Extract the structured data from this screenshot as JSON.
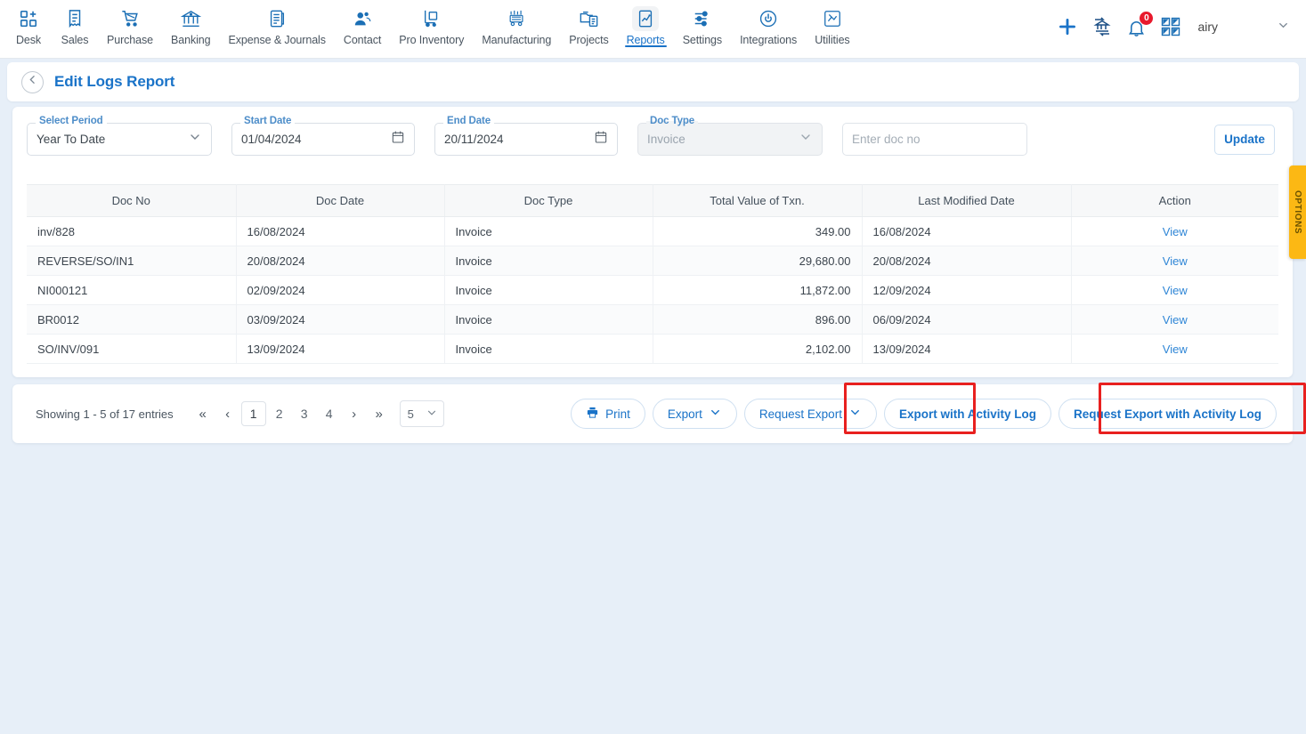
{
  "topnav": {
    "items": [
      {
        "label": "Desk",
        "icon": "dashboard-add-icon",
        "active": false
      },
      {
        "label": "Sales",
        "icon": "receipt-icon",
        "active": false
      },
      {
        "label": "Purchase",
        "icon": "cart-icon",
        "active": false
      },
      {
        "label": "Banking",
        "icon": "bank-icon",
        "active": false
      },
      {
        "label": "Expense & Journals",
        "icon": "ledger-book-icon",
        "active": false
      },
      {
        "label": "Contact",
        "icon": "people-icon",
        "active": false
      },
      {
        "label": "Pro Inventory",
        "icon": "hand-truck-icon",
        "active": false
      },
      {
        "label": "Manufacturing",
        "icon": "factory-machine-icon",
        "active": false
      },
      {
        "label": "Projects",
        "icon": "project-folder-icon",
        "active": false
      },
      {
        "label": "Reports",
        "icon": "report-chart-icon",
        "active": true
      },
      {
        "label": "Settings",
        "icon": "sliders-icon",
        "active": false
      },
      {
        "label": "Integrations",
        "icon": "plug-icon",
        "active": false
      },
      {
        "label": "Utilities",
        "icon": "utilities-icon",
        "active": false
      }
    ],
    "right": {
      "add_icon": "plus-icon",
      "bank_transfer_icon": "bank-transfer-icon",
      "notification_icon": "bell-icon",
      "notification_count": "0",
      "apps_icon": "grid-apps-icon",
      "org_name": "airy",
      "caret_icon": "chevron-down-icon"
    }
  },
  "page": {
    "back_icon": "chevron-left-icon",
    "title": "Edit Logs Report"
  },
  "filters": {
    "period": {
      "label": "Select Period",
      "value": "Year To Date",
      "caret": "chevron-down-icon"
    },
    "start_date": {
      "label": "Start Date",
      "value": "01/04/2024",
      "icon": "calendar-icon"
    },
    "end_date": {
      "label": "End Date",
      "value": "20/11/2024",
      "icon": "calendar-icon"
    },
    "doc_type": {
      "label": "Doc Type",
      "value": "Invoice",
      "caret": "chevron-down-icon"
    },
    "doc_no": {
      "placeholder": "Enter doc no",
      "value": ""
    },
    "update_label": "Update"
  },
  "options_tab": {
    "label": "OPTIONS"
  },
  "table": {
    "columns": [
      "Doc No",
      "Doc Date",
      "Doc Type",
      "Total Value of Txn.",
      "Last Modified Date",
      "Action"
    ],
    "rows": [
      {
        "doc_no": "inv/828",
        "doc_date": "16/08/2024",
        "doc_type": "Invoice",
        "total": "349.00",
        "modified": "16/08/2024",
        "action": "View"
      },
      {
        "doc_no": "REVERSE/SO/IN1",
        "doc_date": "20/08/2024",
        "doc_type": "Invoice",
        "total": "29,680.00",
        "modified": "20/08/2024",
        "action": "View"
      },
      {
        "doc_no": "NI000121",
        "doc_date": "02/09/2024",
        "doc_type": "Invoice",
        "total": "11,872.00",
        "modified": "12/09/2024",
        "action": "View"
      },
      {
        "doc_no": "BR0012",
        "doc_date": "03/09/2024",
        "doc_type": "Invoice",
        "total": "896.00",
        "modified": "06/09/2024",
        "action": "View"
      },
      {
        "doc_no": "SO/INV/091",
        "doc_date": "13/09/2024",
        "doc_type": "Invoice",
        "total": "2,102.00",
        "modified": "13/09/2024",
        "action": "View"
      }
    ]
  },
  "footer": {
    "showing": "Showing 1 - 5 of 17 entries",
    "pager": {
      "first": "«",
      "prev": "‹",
      "next": "›",
      "last": "»",
      "pages": [
        "1",
        "2",
        "3",
        "4"
      ],
      "active_page": "1",
      "per_page": "5",
      "per_page_caret": "chevron-down-icon"
    },
    "buttons": {
      "print": "Print",
      "print_icon": "printer-icon",
      "export": "Export",
      "export_caret": "chevron-down-icon",
      "request_export": "Request Export",
      "request_export_caret": "chevron-down-icon",
      "export_activity": "Export with Activity Log",
      "request_export_activity": "Request Export with Activity Log"
    }
  },
  "colors": {
    "accent": "#1a73c8",
    "page_bg": "#e7eff8",
    "highlight": "#e8201f",
    "options_tab": "#fcb814",
    "badge": "#e8192c"
  }
}
